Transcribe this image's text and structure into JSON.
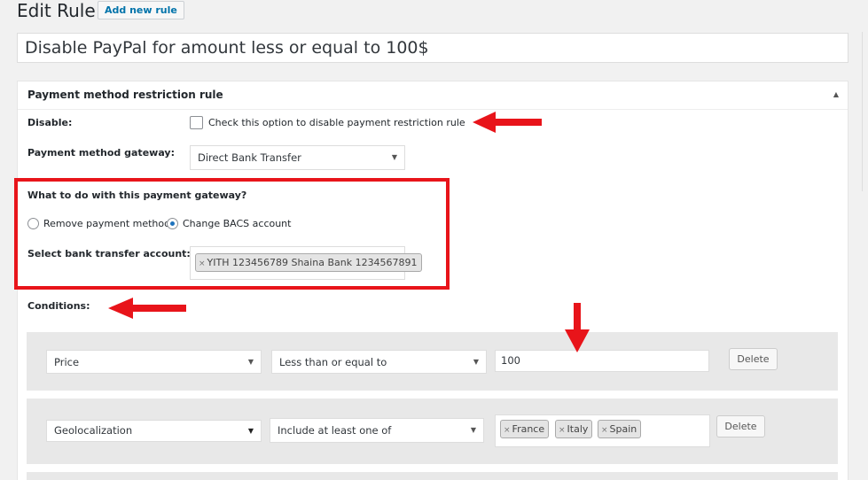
{
  "header": {
    "title": "Edit Rule",
    "add_new_label": "Add new rule"
  },
  "rule_title": "Disable PayPal for amount less or equal to 100$",
  "metabox": {
    "title": "Payment method restriction rule",
    "disable_label": "Disable:",
    "disable_checkbox_text": "Check this option to disable payment restriction rule",
    "gateway_label": "Payment method gateway:",
    "gateway_value": "Direct Bank Transfer",
    "what_to_do_label": "What to do with this payment gateway?",
    "options": [
      "Remove payment method",
      "Change BACS account"
    ],
    "selected_option": "Change BACS account",
    "bank_label": "Select bank transfer account:",
    "bank_tag": "YITH 123456789 Shaina Bank 1234567891",
    "conditions_label": "Conditions:"
  },
  "conditions": [
    {
      "field": "Price",
      "operator": "Less than or equal to",
      "value": "100",
      "delete_label": "Delete"
    },
    {
      "field": "Geolocalization",
      "operator": "Include at least one of",
      "tags": [
        "France",
        "Italy",
        "Spain"
      ],
      "delete_label": "Delete"
    }
  ],
  "colors": {
    "annotation_red": "#e8141a",
    "link_blue": "#0073aa",
    "radio_blue": "#1e73be"
  }
}
